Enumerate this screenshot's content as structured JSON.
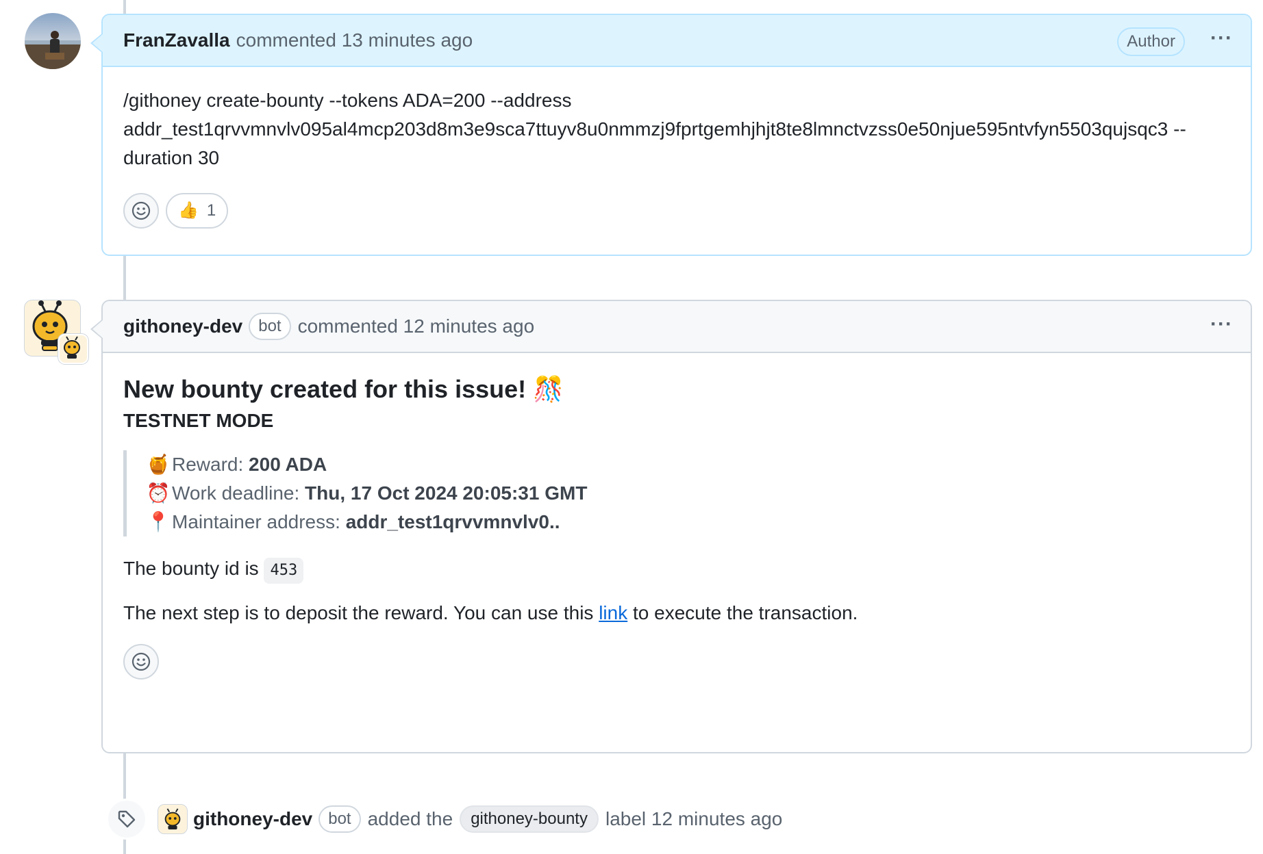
{
  "comment1": {
    "author": "FranZavalla",
    "meta": "commented 13 minutes ago",
    "badge": "Author",
    "menu": "···",
    "line1": "/githoney create-bounty --tokens ADA=200 --address",
    "line2": "addr_test1qrvvmnvlv095al4mcp203d8m3e9sca7ttuyv8u0nmmzj9fprtgemhjhjt8te8lmnctvzss0e50njue595ntvfyn5503qujsqc3 --",
    "line3": "duration 30",
    "reaction_emoji": "👍",
    "reaction_count": "1",
    "add_reaction_icon": "smiley-icon"
  },
  "comment2": {
    "author": "githoney-dev",
    "bot_badge": "bot",
    "meta": "commented 12 minutes ago",
    "menu": "···",
    "title": "New bounty created for this issue! 🎊",
    "mode": "TESTNET MODE",
    "reward_emoji": "🍯",
    "reward_label": "Reward: ",
    "reward_value": "200 ADA",
    "deadline_emoji": "⏰",
    "deadline_label": "Work deadline: ",
    "deadline_value": "Thu, 17 Oct 2024 20:05:31 GMT",
    "address_emoji": "📍",
    "address_label": "Maintainer address: ",
    "address_value": "addr_test1qrvvmnvlv0..",
    "bounty_id_prefix": "The bounty id is ",
    "bounty_id": "453",
    "next_step_prefix": "The next step is to deposit the reward. You can use this ",
    "link_text": "link",
    "next_step_suffix": " to execute the transaction.",
    "add_reaction_icon": "smiley-icon"
  },
  "event": {
    "actor": "githoney-dev",
    "bot_badge": "bot",
    "action": "added the",
    "label": "githoney-bounty",
    "suffix": "label 12 minutes ago",
    "icon": "tag-icon"
  }
}
